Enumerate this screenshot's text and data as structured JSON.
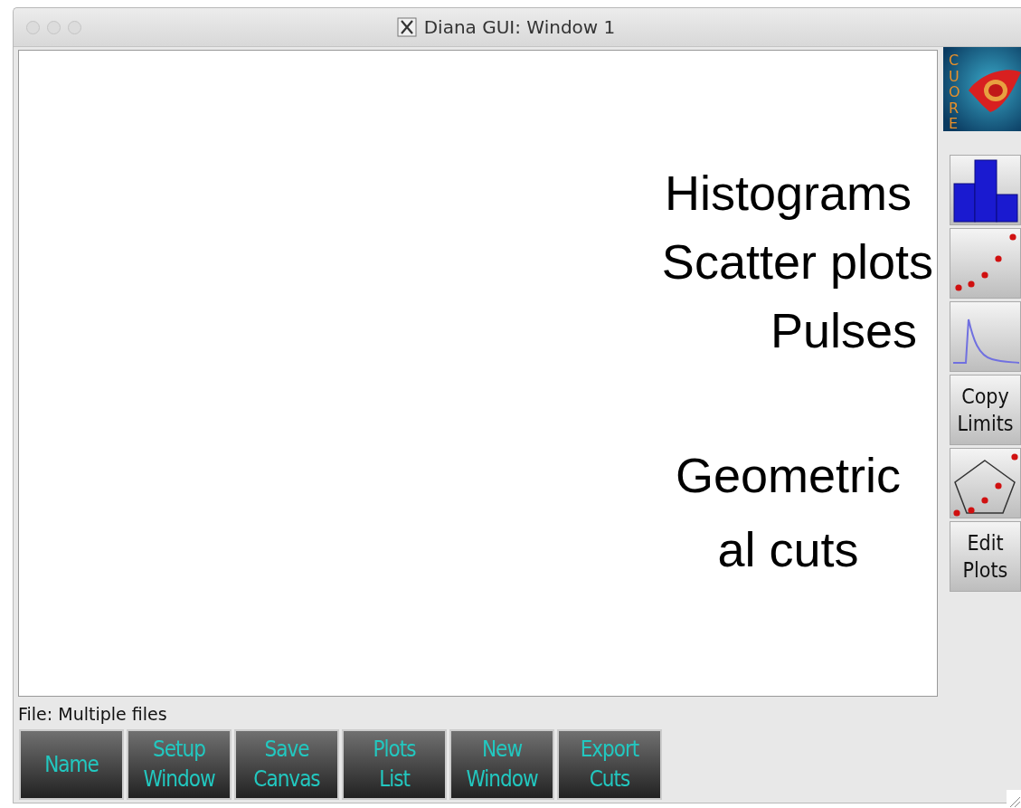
{
  "window": {
    "title": "Diana GUI:  Window 1"
  },
  "annotations": [
    {
      "text": "Histograms"
    },
    {
      "text": "Scatter plots"
    },
    {
      "text": "Pulses"
    },
    {
      "text": "Geometric\nal cuts"
    }
  ],
  "logo": {
    "text": "CUORE"
  },
  "toolbar": [
    {
      "kind": "histogram"
    },
    {
      "kind": "scatter"
    },
    {
      "kind": "pulse"
    },
    {
      "kind": "text",
      "label": "Copy\nLimits"
    },
    {
      "kind": "polygon"
    },
    {
      "kind": "text",
      "label": "Edit\nPlots"
    }
  ],
  "status": "File:  Multiple files",
  "buttons": [
    "Name",
    "Setup\nWindow",
    "Save\nCanvas",
    "Plots\nList",
    "New\nWindow",
    "Export\nCuts"
  ]
}
